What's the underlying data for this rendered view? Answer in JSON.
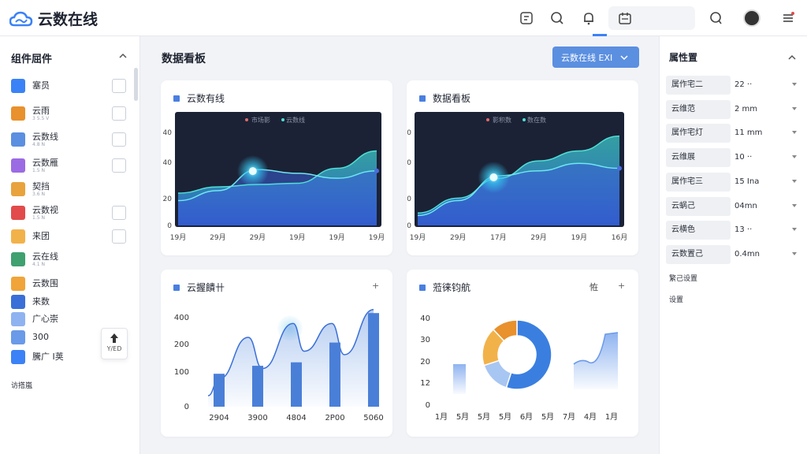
{
  "app": {
    "title": "云数在线"
  },
  "topbar": {
    "icons": [
      "app-grid-icon",
      "search-icon",
      "bell-icon",
      "calendar-icon",
      "chat-icon",
      "user-avatar",
      "menu-icon"
    ]
  },
  "sidebar": {
    "header": "组件屈件",
    "items": [
      {
        "label": "塞员",
        "sub": "",
        "color": "#3b82f6",
        "side": true
      },
      {
        "label": "云雨",
        "sub": "3 5.5 V",
        "color": "#e8912d",
        "side": true
      },
      {
        "label": "云数线",
        "sub": "4.8 N",
        "color": "#5b8fe0",
        "side": true
      },
      {
        "label": "云数雁",
        "sub": "1.5 N",
        "color": "#9b6be3",
        "side": true
      },
      {
        "label": "契挡",
        "sub": "3.6 N",
        "color": "#e8a33d",
        "side": false
      },
      {
        "label": "云数视",
        "sub": "1.5 N",
        "color": "#e24b4b",
        "side": true
      },
      {
        "label": "来团",
        "sub": "",
        "color": "#f2b24a",
        "side": true
      },
      {
        "label": "云在线",
        "sub": "4.1 N",
        "color": "#3fa070",
        "side": false
      },
      {
        "label": "云数围",
        "sub": "",
        "color": "#f0a43a",
        "side": false
      },
      {
        "label": "来数",
        "sub": "",
        "color": "#3a6fd8",
        "side": false
      },
      {
        "label": "广心崇",
        "sub": "",
        "color": "#8fb3f0",
        "side": false
      },
      {
        "label": "300",
        "sub": "",
        "color": "#6a9ae8",
        "side": false
      },
      {
        "label": "騰广 I荚",
        "sub": "",
        "color": "#3b82f6",
        "side": false
      }
    ],
    "footer": "访搭嵐",
    "tooltip": "Y/ED"
  },
  "main": {
    "title": "数据看板",
    "button": "云数在线 EXI",
    "cards": [
      {
        "title": "云数有线",
        "legend": [
          "市场影",
          "云数线"
        ]
      },
      {
        "title": "数据看板",
        "legend": [
          "影积数",
          "数在数"
        ]
      },
      {
        "title": "云握饋卄",
        "menu": "+"
      },
      {
        "title": "蒞徕钧航",
        "menu_a": "恠",
        "menu_b": "+"
      }
    ]
  },
  "chart_data": [
    {
      "type": "area",
      "title": "云数有线",
      "x": [
        "19月",
        "29月",
        "29月",
        "19月",
        "19月",
        "19月"
      ],
      "ylabels": [
        "0",
        "20",
        "40",
        "40"
      ],
      "series": [
        {
          "name": "市场影",
          "values": [
            26,
            31,
            33,
            34,
            46,
            60
          ]
        },
        {
          "name": "云数线",
          "values": [
            20,
            28,
            45,
            42,
            38,
            44
          ]
        }
      ]
    },
    {
      "type": "area",
      "title": "数据看板",
      "x": [
        "19月",
        "29月",
        "17月",
        "29月",
        "19月",
        "16月"
      ],
      "ylabels": [
        "0",
        "0",
        "0",
        "0"
      ],
      "series": [
        {
          "name": "影积数",
          "values": [
            10,
            22,
            38,
            52,
            60,
            72
          ]
        },
        {
          "name": "数在数",
          "values": [
            8,
            20,
            40,
            44,
            50,
            46
          ]
        }
      ]
    },
    {
      "type": "bar",
      "title": "云握饋卄",
      "categories": [
        "2904",
        "3900",
        "4804",
        "2P00",
        "5060"
      ],
      "ylabels": [
        "0",
        "100",
        "200",
        "400"
      ],
      "values": [
        95,
        118,
        128,
        185,
        270
      ]
    },
    {
      "type": "pie",
      "title": "蒞徕钧航",
      "x": [
        "1月",
        "5月",
        "5月",
        "5月",
        "6月",
        "5月",
        "7月",
        "4月",
        "1月"
      ],
      "ylabels": [
        "0",
        "12",
        "20",
        "30",
        "40"
      ],
      "slices": [
        {
          "value": 55,
          "color": "#3a7fe0"
        },
        {
          "value": 15,
          "color": "#a8c6f2"
        },
        {
          "value": 18,
          "color": "#f2b24a"
        },
        {
          "value": 12,
          "color": "#e8912d"
        }
      ]
    }
  ],
  "rightpanel": {
    "title": "属性置",
    "rows": [
      {
        "k": "属作宅二",
        "v": "22 ··"
      },
      {
        "k": "云维范",
        "v": "2 mm"
      },
      {
        "k": "属作宅灯",
        "v": "11 mm"
      },
      {
        "k": "云维展",
        "v": "10 ··"
      },
      {
        "k": "属作宅三",
        "v": "15 Ina"
      },
      {
        "k": "云蜗己",
        "v": "04mn"
      },
      {
        "k": "云横色",
        "v": "13 ··"
      },
      {
        "k": "云数置己",
        "v": "0.4mn"
      }
    ],
    "notes": [
      "繁己设置",
      "设置"
    ]
  }
}
